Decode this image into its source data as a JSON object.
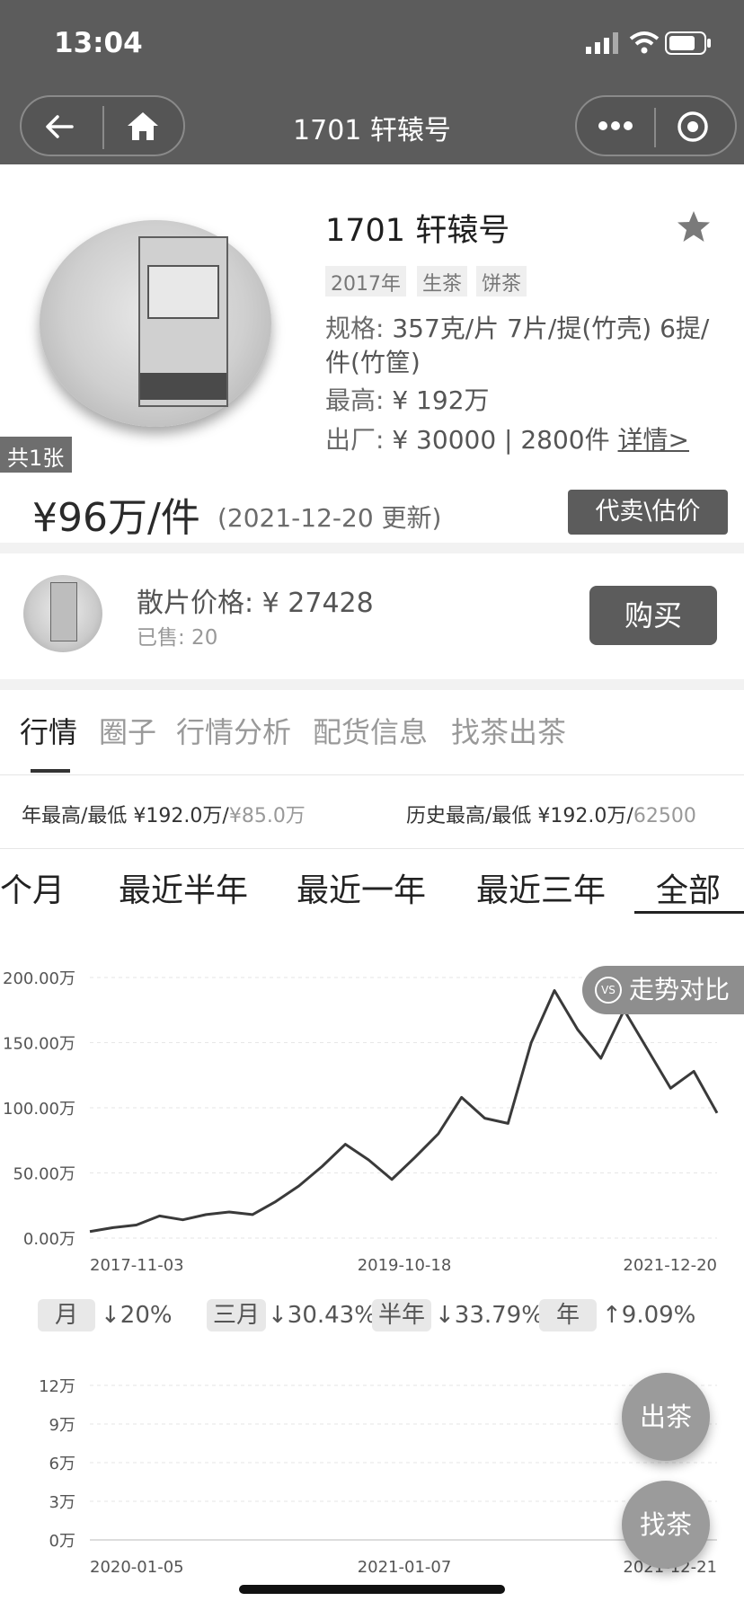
{
  "status_bar": {
    "time": "13:04"
  },
  "nav": {
    "title": "1701 轩辕号"
  },
  "product": {
    "image_count": "共1张",
    "name": "1701 轩辕号",
    "tags": [
      "2017年",
      "生茶",
      "饼茶"
    ],
    "spec_label": "规格:",
    "spec_value_line1": "357克/片 7片/提(竹壳) 6提/",
    "spec_value_line2": "件(竹筐)",
    "high_label": "最高:",
    "high_value": "¥ 192万",
    "factory_label": "出厂:",
    "factory_value": "¥ 30000 | 2800件",
    "detail_link": "详情>",
    "price": "¥96万/件",
    "price_update": "(2021-12-20 更新)",
    "consign_button": "代卖\\估价"
  },
  "loose": {
    "label": "散片价格:",
    "price": "¥ 27428",
    "sold": "已售: 20",
    "buy_button": "购买"
  },
  "tabs": [
    "行情",
    "圈子",
    "行情分析",
    "配货信息",
    "找茶出茶"
  ],
  "stats": {
    "year_label": "年最高/最低",
    "year_high": "¥192.0万/",
    "year_low": "¥85.0万",
    "hist_label": "历史最高/最低",
    "hist_high": "¥192.0万/",
    "hist_low": "62500"
  },
  "ranges": [
    "三个月",
    "最近半年",
    "最近一年",
    "最近三年",
    "全部"
  ],
  "vs_button": "走势对比",
  "changes": [
    {
      "label": "月",
      "value": "↓20%"
    },
    {
      "label": "三月",
      "value": "↓30.43%"
    },
    {
      "label": "半年",
      "value": "↓33.79%"
    },
    {
      "label": "年",
      "value": "↑9.09%"
    }
  ],
  "fab": {
    "sell": "出茶",
    "find": "找茶"
  },
  "chart_data": [
    {
      "type": "line",
      "y_ticks": [
        "200.00万",
        "150.00万",
        "100.00万",
        "50.00万",
        "0.00万"
      ],
      "x_ticks": [
        "2017-11-03",
        "2019-10-18",
        "2021-12-20"
      ],
      "ylim": [
        0,
        200
      ],
      "x": [
        "2017-11",
        "2018-02",
        "2018-05",
        "2018-08",
        "2018-11",
        "2019-02",
        "2019-05",
        "2019-08",
        "2019-10",
        "2020-01",
        "2020-04",
        "2020-06",
        "2020-08",
        "2020-10",
        "2020-11",
        "2020-12",
        "2021-01",
        "2021-02",
        "2021-03",
        "2021-04",
        "2021-05",
        "2021-06",
        "2021-07",
        "2021-08",
        "2021-09",
        "2021-10",
        "2021-11",
        "2021-12"
      ],
      "series": [
        {
          "values": [
            5,
            8,
            10,
            17,
            14,
            18,
            20,
            18,
            28,
            40,
            55,
            72,
            60,
            45,
            62,
            80,
            108,
            92,
            88,
            150,
            190,
            160,
            138,
            175,
            145,
            115,
            128,
            96
          ]
        }
      ],
      "grid": true
    },
    {
      "type": "bar",
      "y_ticks": [
        "12万",
        "9万",
        "6万",
        "3万",
        "0万"
      ],
      "x_ticks": [
        "2020-01-05",
        "2021-01-07",
        "2021-12-21"
      ],
      "ylim": [
        0,
        12
      ],
      "grid": true
    }
  ]
}
